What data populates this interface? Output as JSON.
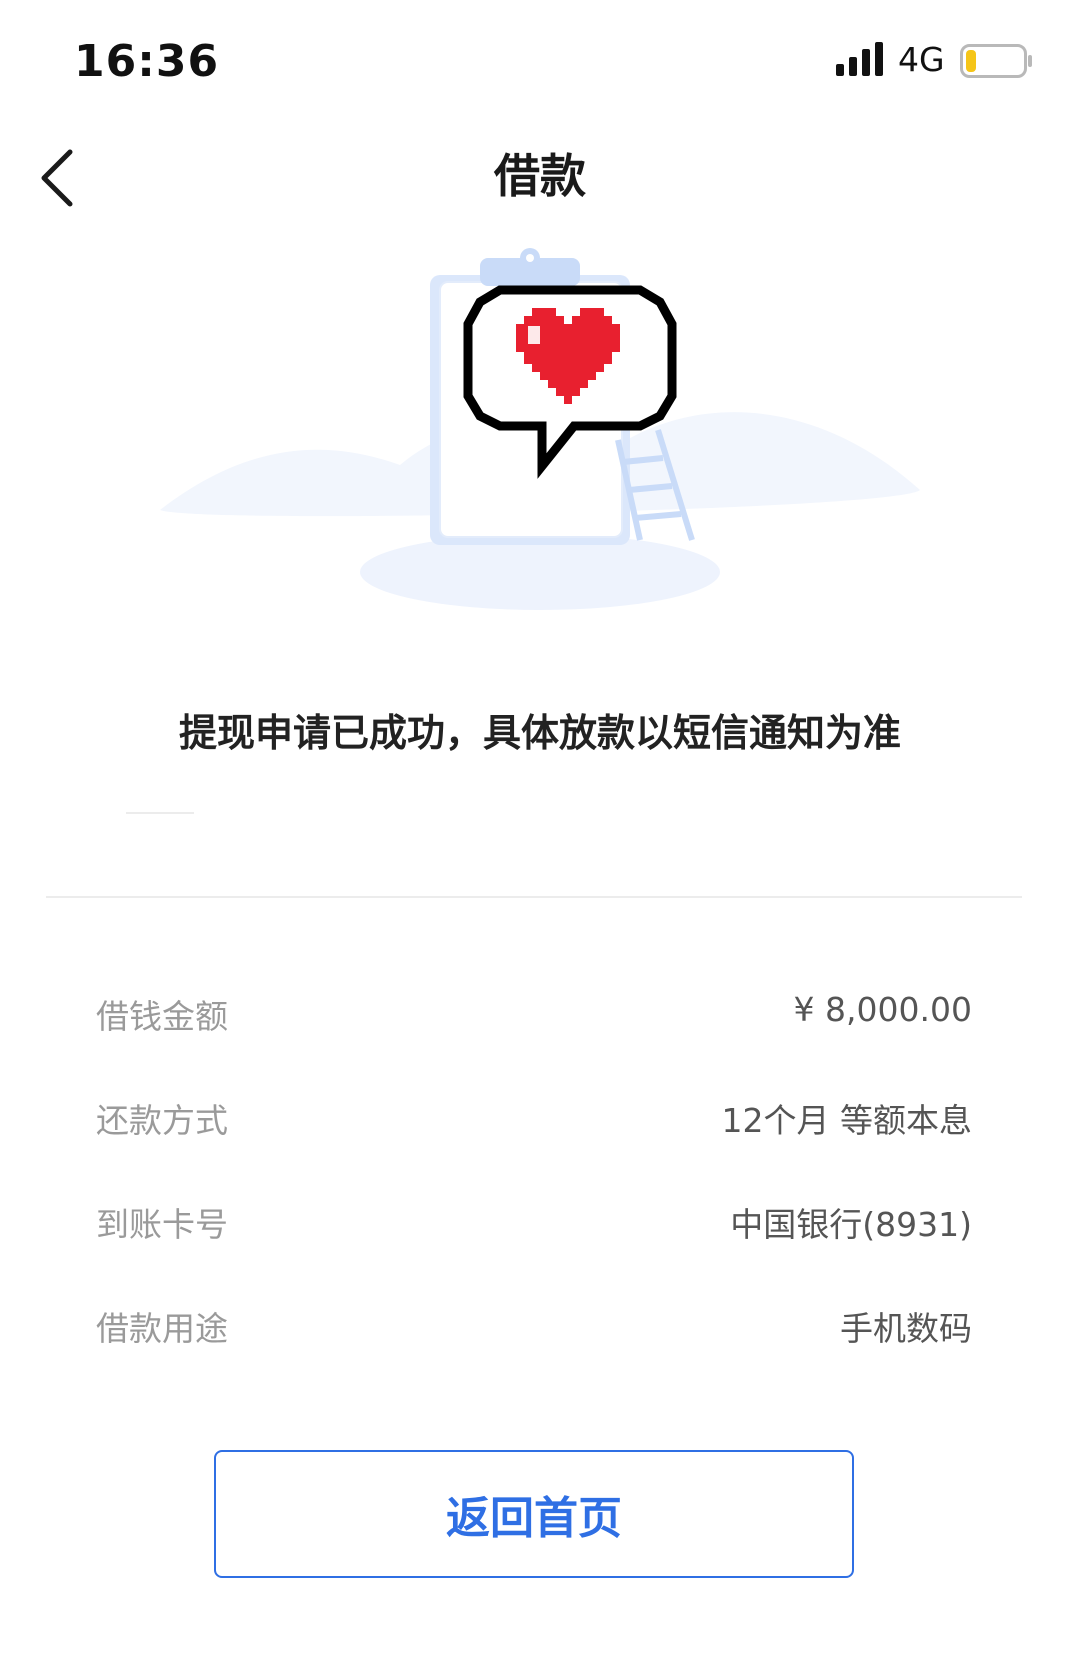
{
  "status_bar": {
    "time": "16:36",
    "network": "4G",
    "battery_color": "#f5c518"
  },
  "nav": {
    "back_icon": "chevron-left-icon",
    "title": "借款"
  },
  "illustration": {
    "icon": "heart-speech-bubble-icon",
    "heart_color": "#e8202f",
    "accent_color": "#dbe7fb"
  },
  "message": "提现申请已成功，具体放款以短信通知为准",
  "details": [
    {
      "label": "借钱金额",
      "value": "¥ 8,000.00"
    },
    {
      "label": "还款方式",
      "value": "12个月 等额本息"
    },
    {
      "label": "到账卡号",
      "value": "中国银行(8931)"
    },
    {
      "label": "借款用途",
      "value": "手机数码"
    }
  ],
  "home_button": {
    "label": "返回首页",
    "color": "#2f6fe4"
  }
}
